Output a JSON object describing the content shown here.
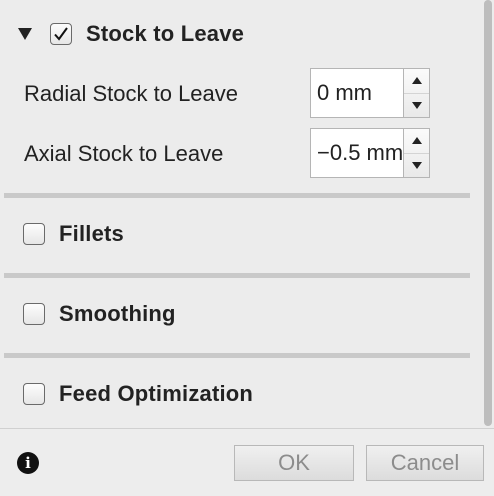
{
  "stock_to_leave": {
    "title": "Stock to Leave",
    "checked": true,
    "expanded": true,
    "radial": {
      "label": "Radial Stock to Leave",
      "value": "0 mm"
    },
    "axial": {
      "label": "Axial Stock to Leave",
      "value": "−0.5 mm"
    }
  },
  "sections": [
    {
      "title": "Fillets",
      "checked": false
    },
    {
      "title": "Smoothing",
      "checked": false
    },
    {
      "title": "Feed Optimization",
      "checked": false
    }
  ],
  "footer": {
    "info_icon_glyph": "i",
    "ok_label": "OK",
    "cancel_label": "Cancel"
  }
}
